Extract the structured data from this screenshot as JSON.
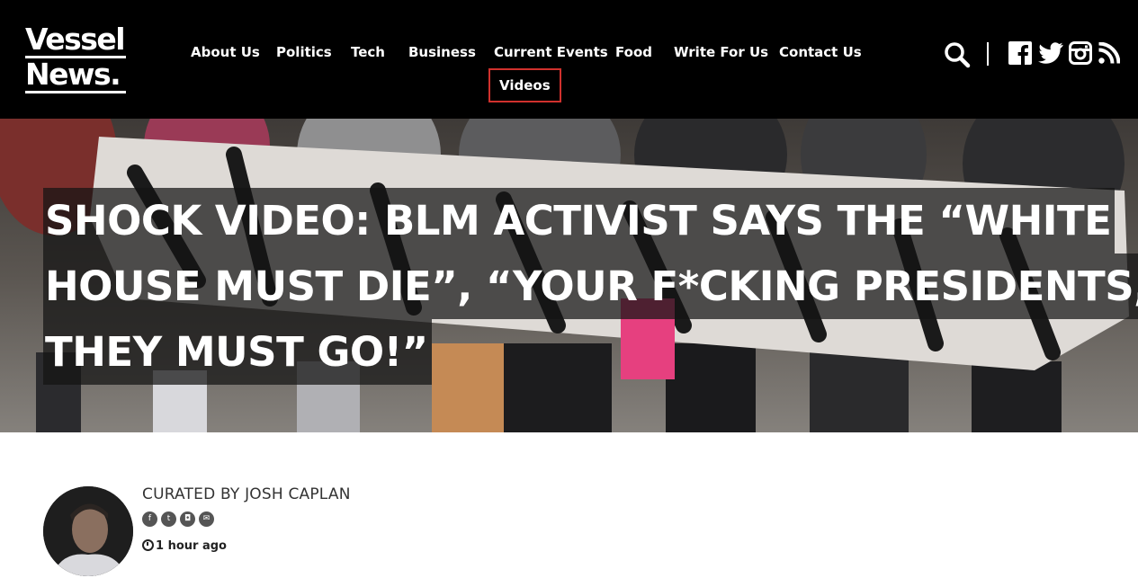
{
  "site": {
    "logo_line1": "Vessel",
    "logo_line2": "News."
  },
  "nav": {
    "items": [
      {
        "label": "About Us"
      },
      {
        "label": "Politics"
      },
      {
        "label": "Tech"
      },
      {
        "label": "Business"
      },
      {
        "label": "Current Events"
      },
      {
        "label": "Food"
      },
      {
        "label": "Write For Us"
      },
      {
        "label": "Contact Us"
      },
      {
        "label": "Videos",
        "active": true
      }
    ],
    "active_border_color": "#d0312d"
  },
  "header_icons": [
    "search-icon",
    "facebook-icon",
    "twitter-icon",
    "instagram-icon",
    "rss-icon"
  ],
  "article": {
    "headline_lines": [
      "SHOCK VIDEO: BLM ACTIVIST SAYS THE “WHITE",
      "HOUSE MUST DIE”, “YOUR F*CKING PRESIDENTS,",
      "THEY MUST GO!”"
    ],
    "curated_by": "CURATED BY JOSH CAPLAN",
    "author_social_icons": [
      "facebook-icon",
      "twitter-icon",
      "instagram-icon",
      "email-icon"
    ],
    "time_ago": "1 hour ago"
  },
  "colors": {
    "header_bg": "#000000",
    "accent": "#d0312d"
  }
}
